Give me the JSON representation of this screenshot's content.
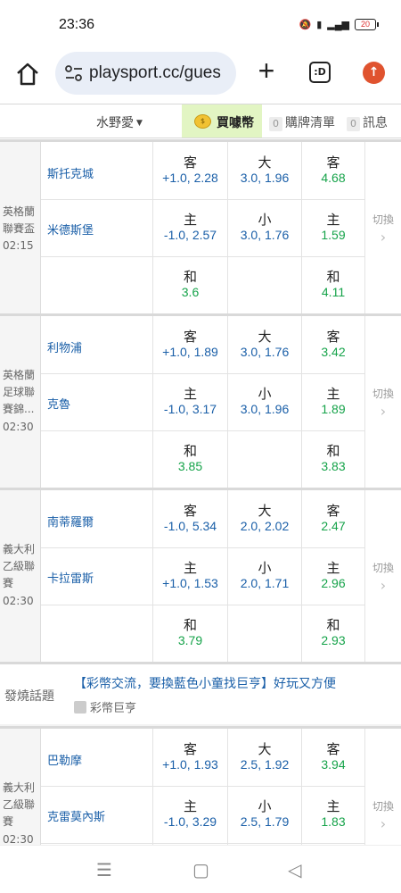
{
  "status": {
    "time": "23:36",
    "battery": "20"
  },
  "browser": {
    "url": "playsport.cc/gues",
    "tabs_label": ":D"
  },
  "nav": {
    "user": "水野愛",
    "buy_coins": "買噱幣",
    "cart_count": "0",
    "cart_label": "購牌清單",
    "msg_count": "0",
    "msg_label": "訊息"
  },
  "switch_label": "切換",
  "matches": [
    {
      "league": "英格蘭聯賽盃",
      "time": "02:15",
      "home": "斯托克城",
      "away": "米德斯堡",
      "rows": [
        {
          "h_lbl": "客",
          "h_val": "+1.0, 2.28",
          "t_lbl": "大",
          "t_val": "3.0, 1.96",
          "m_lbl": "客",
          "m_val": "4.68"
        },
        {
          "h_lbl": "主",
          "h_val": "-1.0, 2.57",
          "t_lbl": "小",
          "t_val": "3.0, 1.76",
          "m_lbl": "主",
          "m_val": "1.59"
        },
        {
          "h_lbl": "和",
          "h_val": "3.6",
          "m_lbl": "和",
          "m_val": "4.11"
        }
      ]
    },
    {
      "league": "英格蘭足球聯賽錦...",
      "time": "02:30",
      "home": "利物浦",
      "away": "克魯",
      "rows": [
        {
          "h_lbl": "客",
          "h_val": "+1.0, 1.89",
          "t_lbl": "大",
          "t_val": "3.0, 1.76",
          "m_lbl": "客",
          "m_val": "3.42"
        },
        {
          "h_lbl": "主",
          "h_val": "-1.0, 3.17",
          "t_lbl": "小",
          "t_val": "3.0, 1.96",
          "m_lbl": "主",
          "m_val": "1.89"
        },
        {
          "h_lbl": "和",
          "h_val": "3.85",
          "m_lbl": "和",
          "m_val": "3.83"
        }
      ]
    },
    {
      "league": "義大利乙級聯賽",
      "time": "02:30",
      "home": "南蒂羅爾",
      "away": "卡拉雷斯",
      "rows": [
        {
          "h_lbl": "客",
          "h_val": "-1.0, 5.34",
          "t_lbl": "大",
          "t_val": "2.0, 2.02",
          "m_lbl": "客",
          "m_val": "2.47"
        },
        {
          "h_lbl": "主",
          "h_val": "+1.0, 1.53",
          "t_lbl": "小",
          "t_val": "2.0, 1.71",
          "m_lbl": "主",
          "m_val": "2.96"
        },
        {
          "h_lbl": "和",
          "h_val": "3.79",
          "m_lbl": "和",
          "m_val": "2.93"
        }
      ]
    },
    {
      "league": "義大利乙級聯賽",
      "time": "02:30",
      "home": "巴勒摩",
      "away": "克雷莫內斯",
      "rows": [
        {
          "h_lbl": "客",
          "h_val": "+1.0, 1.93",
          "t_lbl": "大",
          "t_val": "2.5, 1.92",
          "m_lbl": "客",
          "m_val": "3.94"
        },
        {
          "h_lbl": "主",
          "h_val": "-1.0, 3.29",
          "t_lbl": "小",
          "t_val": "2.5, 1.79",
          "m_lbl": "主",
          "m_val": "1.83"
        }
      ]
    }
  ],
  "hot_topic": {
    "label": "發燒話題",
    "title": "【彩幣交流，要換藍色小童找巨亨】好玩又方便",
    "author": "彩幣巨亨"
  }
}
